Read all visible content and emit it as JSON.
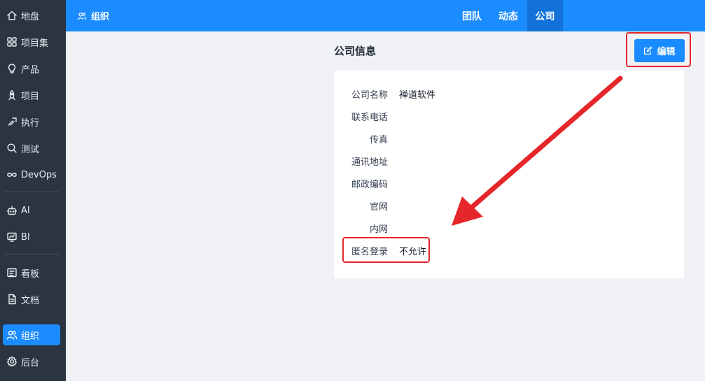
{
  "sidebar": {
    "items": [
      {
        "label": "地盘",
        "icon": "home-icon"
      },
      {
        "label": "项目集",
        "icon": "grid-icon"
      },
      {
        "label": "产品",
        "icon": "lightbulb-icon"
      },
      {
        "label": "项目",
        "icon": "rocket-icon"
      },
      {
        "label": "执行",
        "icon": "run-icon"
      },
      {
        "label": "测试",
        "icon": "search-icon"
      },
      {
        "label": "DevOps",
        "icon": "infinity-icon"
      },
      {
        "label": "AI",
        "icon": "robot-icon"
      },
      {
        "label": "BI",
        "icon": "chart-icon"
      },
      {
        "label": "看板",
        "icon": "kanban-icon"
      },
      {
        "label": "文档",
        "icon": "document-icon"
      },
      {
        "label": "组织",
        "icon": "users-icon"
      },
      {
        "label": "后台",
        "icon": "gear-icon"
      }
    ],
    "active_index": 11
  },
  "topbar": {
    "breadcrumb": "组织",
    "tabs": [
      "团队",
      "动态",
      "公司"
    ],
    "active_tab": 2
  },
  "page": {
    "title": "公司信息",
    "edit_label": "编辑"
  },
  "company": {
    "rows": [
      {
        "label": "公司名称",
        "value": "禅道软件"
      },
      {
        "label": "联系电话",
        "value": ""
      },
      {
        "label": "传真",
        "value": ""
      },
      {
        "label": "通讯地址",
        "value": ""
      },
      {
        "label": "邮政编码",
        "value": ""
      },
      {
        "label": "官网",
        "value": ""
      },
      {
        "label": "内网",
        "value": ""
      },
      {
        "label": "匿名登录",
        "value": "不允许"
      }
    ]
  },
  "colors": {
    "primary": "#1a8cff",
    "sidebar_bg": "#2b3441",
    "annotation_red": "#e5262a"
  }
}
